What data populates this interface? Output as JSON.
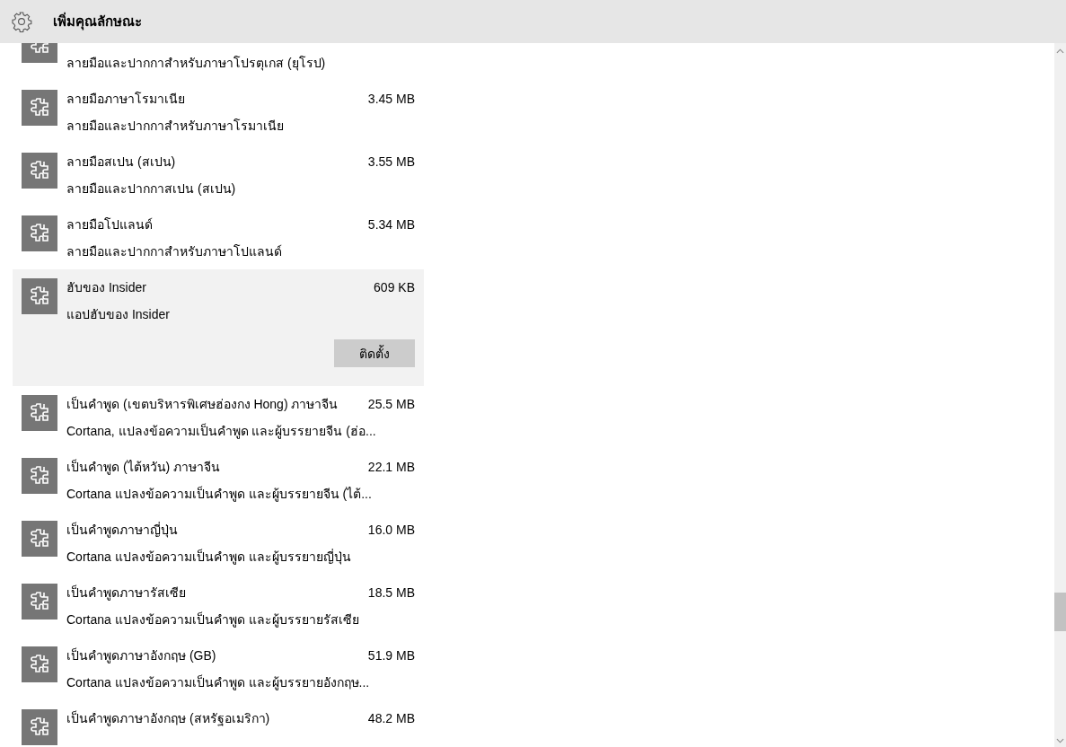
{
  "header": {
    "title": "เพิ่มคุณลักษณะ"
  },
  "features": [
    {
      "description": "ลายมือและปากกาสำหรับภาษาโปรตุเกส (ยุโรป)",
      "selected": false
    },
    {
      "title": "ลายมือภาษาโรมาเนีย",
      "size": "3.45 MB",
      "description": "ลายมือและปากกาสำหรับภาษาโรมาเนีย",
      "selected": false
    },
    {
      "title": "ลายมือสเปน (สเปน)",
      "size": "3.55 MB",
      "description": "ลายมือและปากกาสเปน (สเปน)",
      "selected": false
    },
    {
      "title": "ลายมือโปแลนด์",
      "size": "5.34 MB",
      "description": "ลายมือและปากกาสำหรับภาษาโปแลนด์",
      "selected": false
    },
    {
      "title": "ฮับของ Insider",
      "size": "609 KB",
      "description": "แอปฮับของ Insider",
      "selected": true,
      "button": "ติดตั้ง"
    },
    {
      "title": "เป็นคำพูด (เขตบริหารพิเศษฮ่องกง Hong) ภาษาจีน",
      "size": "25.5 MB",
      "description": "Cortana, แปลงข้อความเป็นคำพูด และผู้บรรยายจีน (ฮ่อ...",
      "selected": false
    },
    {
      "title": "เป็นคำพูด (ไต้หวัน) ภาษาจีน",
      "size": "22.1 MB",
      "description": "Cortana แปลงข้อความเป็นคำพูด และผู้บรรยายจีน (ไต้...",
      "selected": false
    },
    {
      "title": "เป็นคำพูดภาษาญี่ปุ่น",
      "size": "16.0 MB",
      "description": "Cortana แปลงข้อความเป็นคำพูด และผู้บรรยายญี่ปุ่น",
      "selected": false
    },
    {
      "title": "เป็นคำพูดภาษารัสเซีย",
      "size": "18.5 MB",
      "description": "Cortana แปลงข้อความเป็นคำพูด และผู้บรรยายรัสเซีย",
      "selected": false
    },
    {
      "title": "เป็นคำพูดภาษาอังกฤษ (GB)",
      "size": "51.9 MB",
      "description": "Cortana แปลงข้อความเป็นคำพูด และผู้บรรยายอังกฤษ...",
      "selected": false
    },
    {
      "title": "เป็นคำพูดภาษาอังกฤษ (สหรัฐอเมริกา)",
      "size": "48.2 MB",
      "selected": false
    }
  ]
}
